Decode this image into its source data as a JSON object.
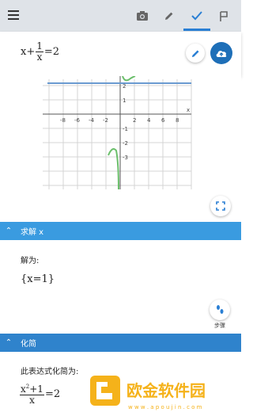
{
  "topbar": {
    "icons": [
      "menu-icon",
      "camera-icon",
      "pencil-icon",
      "checkmark-icon",
      "flag-icon"
    ],
    "active_tab": "checkmark"
  },
  "expression": {
    "lhs": "x+",
    "num": "1",
    "den": "x",
    "rhs": "=2"
  },
  "graph": {
    "x_axis_label": "x",
    "x_ticks": [
      "-8",
      "-6",
      "-4",
      "-2",
      "2",
      "4",
      "6",
      "8"
    ],
    "y_ticks": [
      "2",
      "1",
      "-1",
      "-2",
      "-3"
    ],
    "line_color": "#6a9ad0",
    "curve_color": "#6bbf6b"
  },
  "solve": {
    "header": "求解 x",
    "label": "解为:",
    "result": "{x=1}",
    "header_color": "#3a9be0"
  },
  "steps_label": "步骤",
  "simplify": {
    "header": "化简",
    "label": "此表达式化简为:",
    "result_num_base": "x",
    "result_num_exp": "2",
    "result_num_rest": "+1",
    "result_den": "x",
    "result_rhs": "=2",
    "header_color": "#2f83cc"
  },
  "watermark": {
    "text": "欧金软件园",
    "url": "w w w . a p o u j i n . c o m"
  }
}
